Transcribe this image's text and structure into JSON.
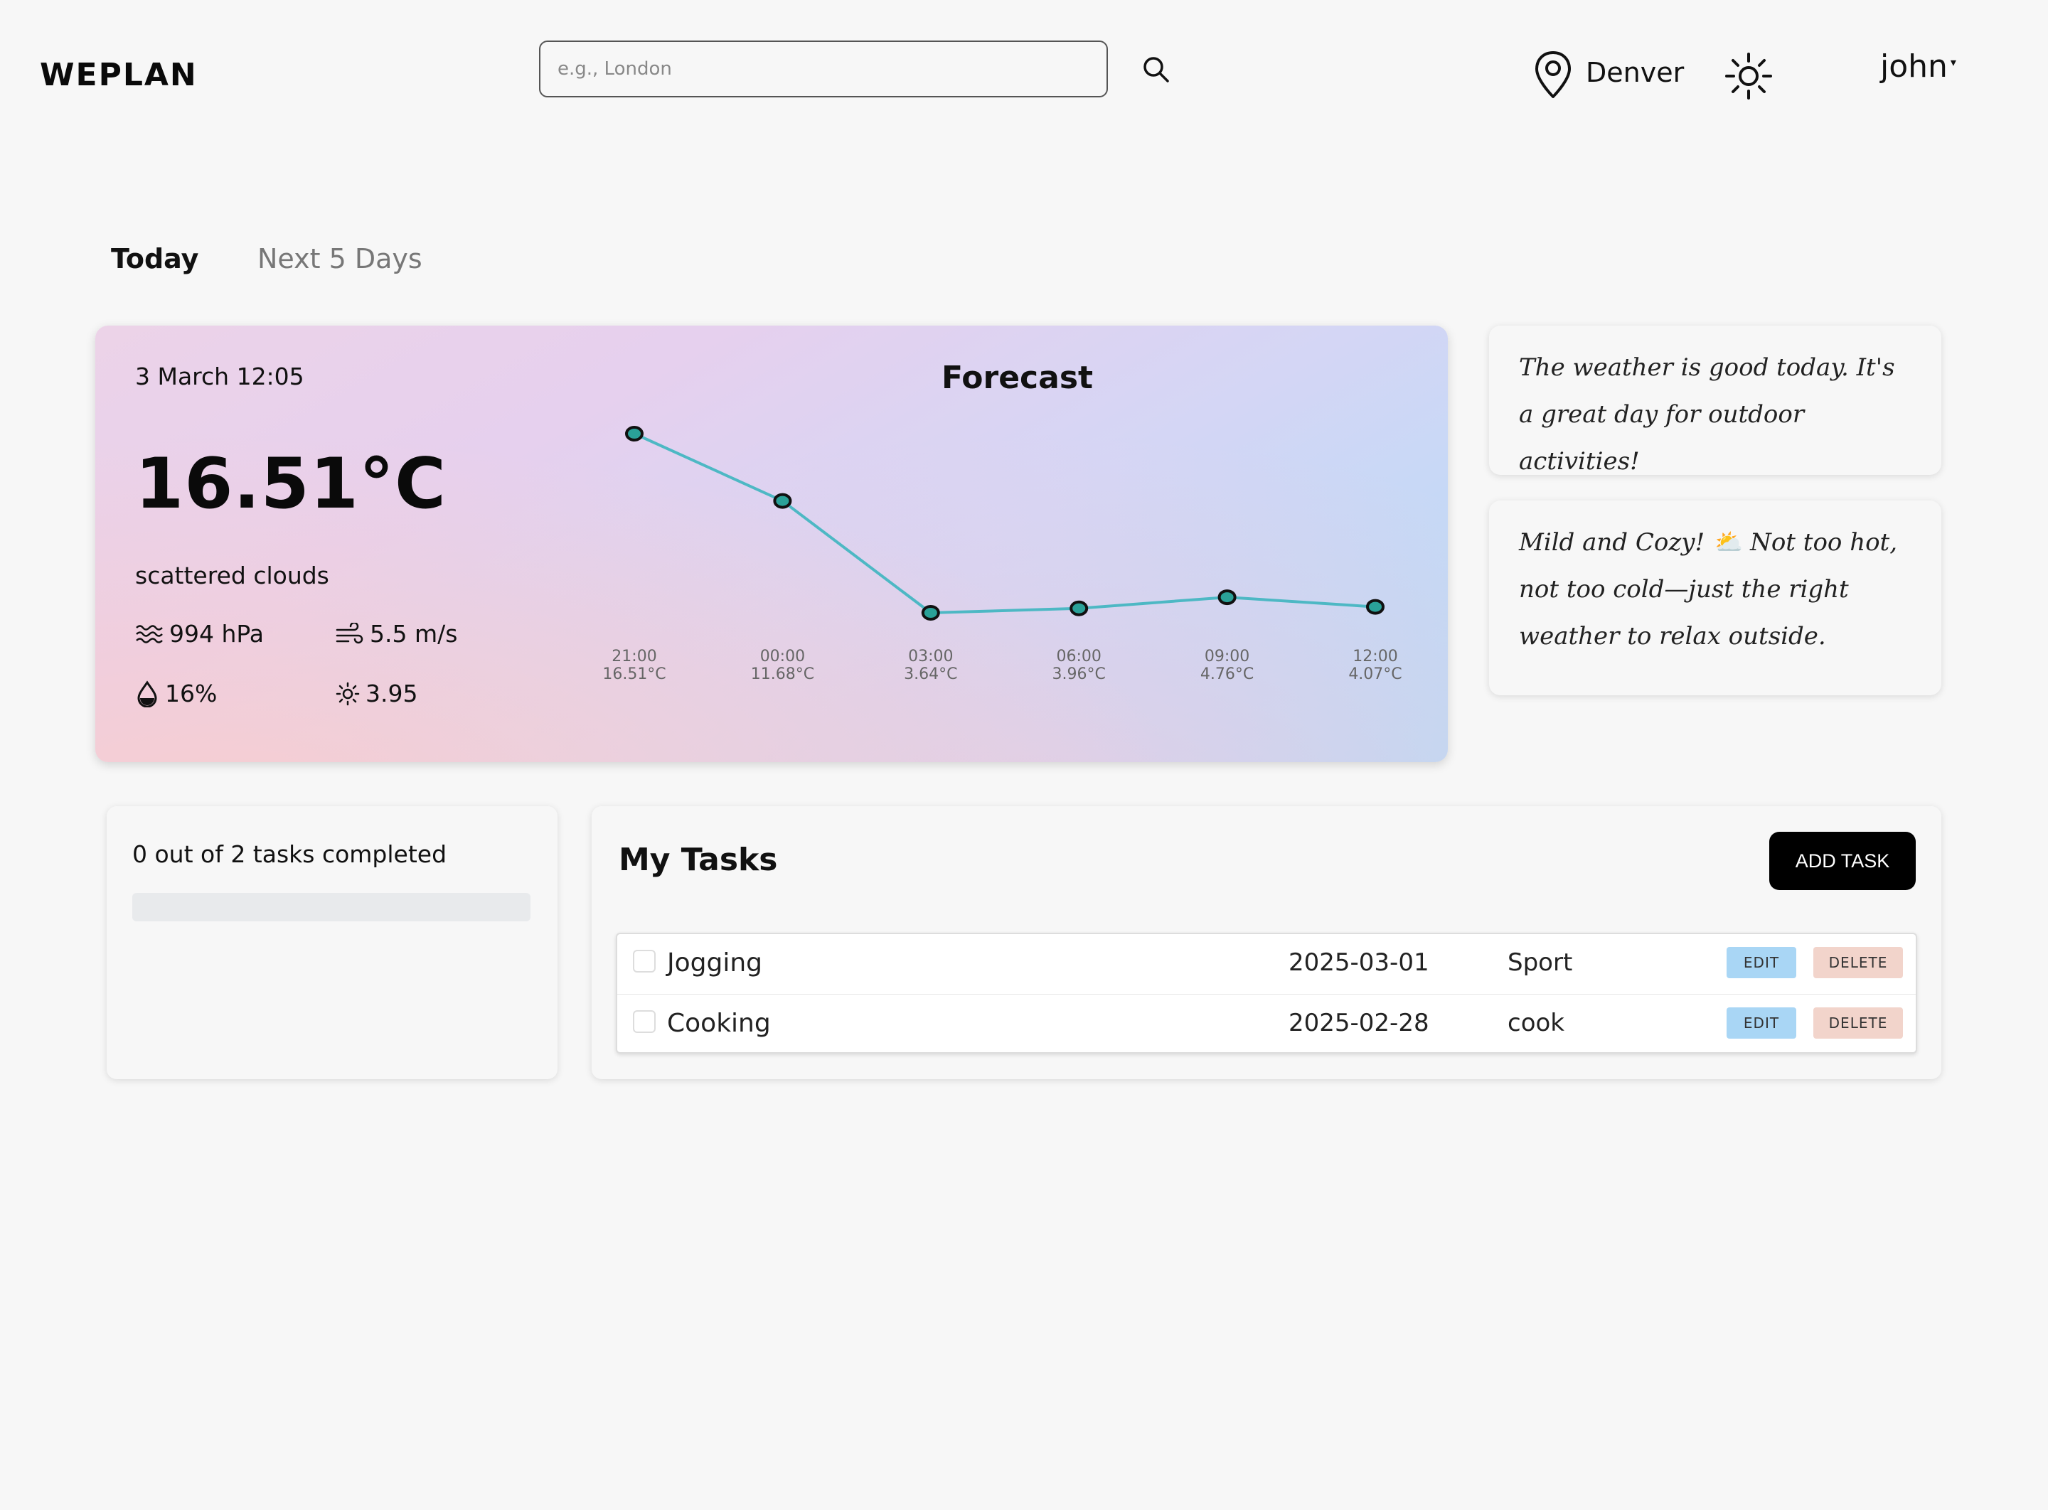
{
  "header": {
    "logo": "WEPLAN",
    "search_placeholder": "e.g., London",
    "location": "Denver",
    "user": "john"
  },
  "tabs": [
    {
      "label": "Today",
      "active": true
    },
    {
      "label": "Next 5 Days",
      "active": false
    }
  ],
  "weather": {
    "datetime": "3 March 12:05",
    "temperature": "16.51°C",
    "description": "scattered clouds",
    "pressure": "994 hPa",
    "wind": "5.5 m/s",
    "humidity": "16%",
    "uv": "3.95",
    "forecast_title": "Forecast"
  },
  "chart_data": {
    "type": "line",
    "title": "Forecast",
    "x": [
      "21:00",
      "00:00",
      "03:00",
      "06:00",
      "09:00",
      "12:00"
    ],
    "x_sublabels": [
      "16.51°C",
      "11.68°C",
      "3.64°C",
      "3.96°C",
      "4.76°C",
      "4.07°C"
    ],
    "values": [
      16.51,
      11.68,
      3.64,
      3.96,
      4.76,
      4.07
    ],
    "ylim": [
      3.64,
      16.51
    ],
    "line_color": "#4db8c4",
    "point_color": "#2aa198"
  },
  "tips": [
    "The weather is good today. It's a great day for outdoor activities!",
    "Mild and Cozy! ⛅ Not too hot, not too cold—just the right weather to relax outside."
  ],
  "progress": {
    "text": "0 out of 2 tasks completed",
    "completed": 0,
    "total": 2
  },
  "tasks": {
    "title": "My Tasks",
    "add_label": "ADD TASK",
    "edit_label": "EDIT",
    "delete_label": "DELETE",
    "items": [
      {
        "name": "Jogging",
        "date": "2025-03-01",
        "category": "Sport",
        "done": false
      },
      {
        "name": "Cooking",
        "date": "2025-02-28",
        "category": "cook",
        "done": false
      }
    ]
  }
}
